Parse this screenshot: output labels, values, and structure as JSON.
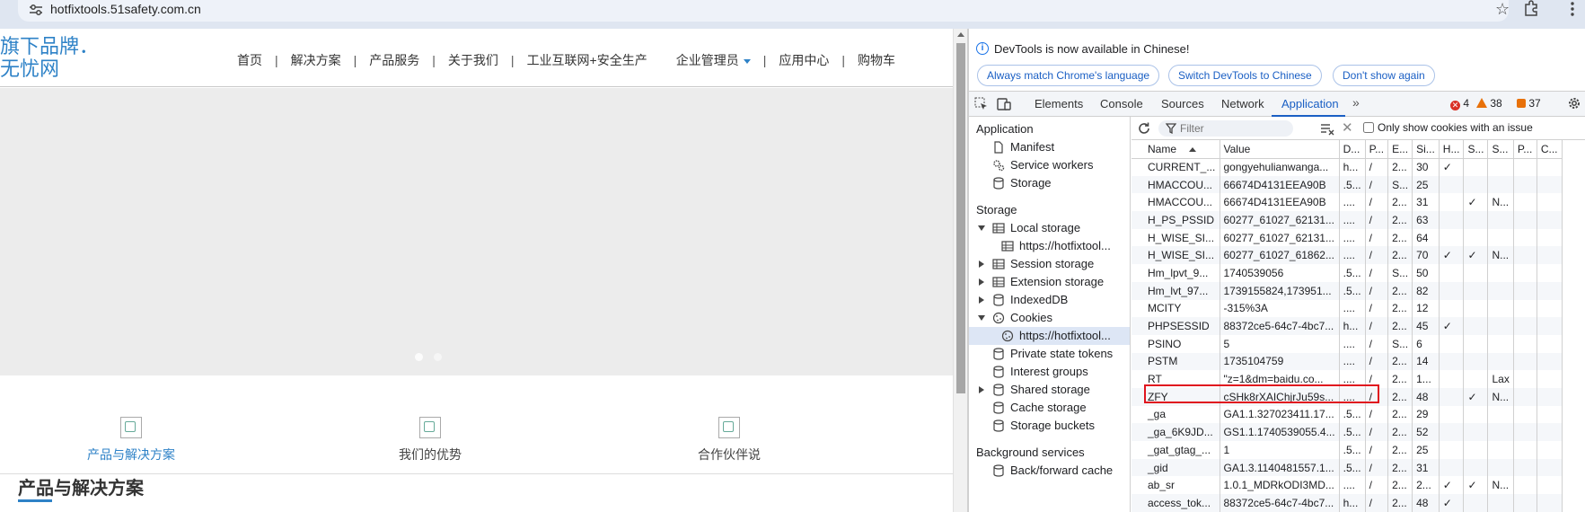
{
  "browser": {
    "url": "hotfixtools.51safety.com.cn"
  },
  "site": {
    "logo_line1": "旗下品牌．",
    "logo_line2": "无忧网",
    "nav": [
      {
        "label": "首页"
      },
      {
        "label": "解决方案"
      },
      {
        "label": "产品服务"
      },
      {
        "label": "关于我们"
      },
      {
        "label": "工业互联网+安全生产"
      },
      {
        "label": "企业管理员"
      },
      {
        "label": "应用中心"
      },
      {
        "label": "购物车"
      }
    ],
    "nav_separator": "|",
    "features": [
      {
        "label": "产品与解决方案"
      },
      {
        "label": "我们的优势"
      },
      {
        "label": "合作伙伴说"
      }
    ],
    "section_title": "产品与解决方案",
    "accent_color": "#2e82c7"
  },
  "devtools": {
    "infobar": {
      "message": "DevTools is now available in Chinese!",
      "buttons": [
        "Always match Chrome's language",
        "Switch DevTools to Chinese",
        "Don't show again"
      ]
    },
    "tabs": [
      "Elements",
      "Console",
      "Sources",
      "Network",
      "Application"
    ],
    "active_tab": "Application",
    "counts": {
      "errors": "4",
      "warnings": "38",
      "issues": "37"
    },
    "tree": {
      "application_header": "Application",
      "application_items": [
        "Manifest",
        "Service workers",
        "Storage"
      ],
      "storage_header": "Storage",
      "local_storage": "Local storage",
      "local_storage_child": "https://hotfixtool...",
      "session_storage": "Session storage",
      "extension_storage": "Extension storage",
      "indexeddb": "IndexedDB",
      "cookies": "Cookies",
      "cookies_child": "https://hotfixtool...",
      "private_state_tokens": "Private state tokens",
      "interest_groups": "Interest groups",
      "shared_storage": "Shared storage",
      "cache_storage": "Cache storage",
      "storage_buckets": "Storage buckets",
      "background_header": "Background services",
      "back_forward_cache": "Back/forward cache"
    },
    "cookie_toolbar": {
      "filter_placeholder": "Filter",
      "only_issue_label": "Only show cookies with an issue"
    },
    "columns": [
      "Name",
      "Value",
      "D...",
      "P...",
      "E...",
      "Si...",
      "H...",
      "S...",
      "S...",
      "P...",
      "C..."
    ],
    "rows": [
      [
        "CURRENT_...",
        "gongyehulianwanga...",
        "h...",
        "/",
        "2...",
        "30",
        "✓",
        "",
        "",
        "",
        ""
      ],
      [
        "HMACCOU...",
        "66674D4131EEA90B",
        ".5...",
        "/",
        "S...",
        "25",
        "",
        "",
        "",
        "",
        ""
      ],
      [
        "HMACCOU...",
        "66674D4131EEA90B",
        "....",
        "/",
        "2...",
        "31",
        "",
        "✓",
        "N...",
        "",
        ""
      ],
      [
        "H_PS_PSSID",
        "60277_61027_62131...",
        "....",
        "/",
        "2...",
        "63",
        "",
        "",
        "",
        "",
        ""
      ],
      [
        "H_WISE_SI...",
        "60277_61027_62131...",
        "....",
        "/",
        "2...",
        "64",
        "",
        "",
        "",
        "",
        ""
      ],
      [
        "H_WISE_SI...",
        "60277_61027_61862...",
        "....",
        "/",
        "2...",
        "70",
        "✓",
        "✓",
        "N...",
        "",
        ""
      ],
      [
        "Hm_lpvt_9...",
        "1740539056",
        ".5...",
        "/",
        "S...",
        "50",
        "",
        "",
        "",
        "",
        ""
      ],
      [
        "Hm_lvt_97...",
        "1739155824,173951...",
        ".5...",
        "/",
        "2...",
        "82",
        "",
        "",
        "",
        "",
        ""
      ],
      [
        "MCITY",
        "-315%3A",
        "....",
        "/",
        "2...",
        "12",
        "",
        "",
        "",
        "",
        ""
      ],
      [
        "PHPSESSID",
        "88372ce5-64c7-4bc7...",
        "h...",
        "/",
        "2...",
        "45",
        "✓",
        "",
        "",
        "",
        ""
      ],
      [
        "PSINO",
        "5",
        "....",
        "/",
        "S...",
        "6",
        "",
        "",
        "",
        "",
        ""
      ],
      [
        "PSTM",
        "1735104759",
        "....",
        "/",
        "2...",
        "14",
        "",
        "",
        "",
        "",
        ""
      ],
      [
        "RT",
        "\"z=1&dm=baidu.co...",
        "....",
        "/",
        "2...",
        "1...",
        "",
        "",
        "Lax",
        "",
        ""
      ],
      [
        "ZFY",
        "cSHk8rXAIChjrJu59s...",
        "....",
        "/",
        "2...",
        "48",
        "",
        "✓",
        "N...",
        "",
        ""
      ],
      [
        "_ga",
        "GA1.1.327023411.17...",
        ".5...",
        "/",
        "2...",
        "29",
        "",
        "",
        "",
        "",
        ""
      ],
      [
        "_ga_6K9JD...",
        "GS1.1.1740539055.4...",
        ".5...",
        "/",
        "2...",
        "52",
        "",
        "",
        "",
        "",
        ""
      ],
      [
        "_gat_gtag_...",
        "1",
        ".5...",
        "/",
        "2...",
        "25",
        "",
        "",
        "",
        "",
        ""
      ],
      [
        "_gid",
        "GA1.3.1140481557.1...",
        ".5...",
        "/",
        "2...",
        "31",
        "",
        "",
        "",
        "",
        ""
      ],
      [
        "ab_sr",
        "1.0.1_MDRkODI3MD...",
        "....",
        "/",
        "2...",
        "2...",
        "✓",
        "✓",
        "N...",
        "",
        ""
      ],
      [
        "access_tok...",
        "88372ce5-64c7-4bc7...",
        "h...",
        "/",
        "2...",
        "48",
        "✓",
        "",
        "",
        "",
        ""
      ]
    ],
    "highlighted_row": "PHPSESSID",
    "highlight_color": "#e0141e"
  }
}
